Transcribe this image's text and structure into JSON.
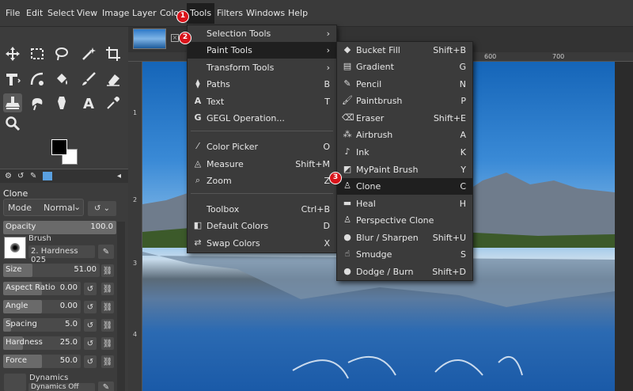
{
  "menubar": [
    "File",
    "Edit",
    "Select",
    "View",
    "Image",
    "Layer",
    "Colors",
    "Tools",
    "Filters",
    "Windows",
    "Help"
  ],
  "tool_options": {
    "title": "Clone",
    "mode_label": "Mode",
    "mode_value": "Normal",
    "opacity": {
      "label": "Opacity",
      "value": "100.0"
    },
    "brush_label": "Brush",
    "brush_value": "2. Hardness 025",
    "size": {
      "label": "Size",
      "value": "51.00"
    },
    "aspect_ratio": {
      "label": "Aspect Ratio",
      "value": "0.00"
    },
    "angle": {
      "label": "Angle",
      "value": "0.00"
    },
    "spacing": {
      "label": "Spacing",
      "value": "5.0"
    },
    "hardness": {
      "label": "Hardness",
      "value": "25.0"
    },
    "force": {
      "label": "Force",
      "value": "50.0"
    },
    "dynamics_label": "Dynamics",
    "dynamics_value": "Dynamics Off"
  },
  "ruler": {
    "top": [
      "600",
      "700"
    ],
    "left": [
      "1",
      "2",
      "3",
      "4"
    ]
  },
  "tools_menu": [
    {
      "label": "Selection Tools",
      "shortcut": "",
      "submenu": true
    },
    {
      "label": "Paint Tools",
      "shortcut": "",
      "submenu": true
    },
    {
      "label": "Transform Tools",
      "shortcut": "",
      "submenu": true
    },
    {
      "label": "Paths",
      "shortcut": "B"
    },
    {
      "label": "Text",
      "shortcut": "T"
    },
    {
      "label": "GEGL Operation...",
      "shortcut": ""
    },
    {
      "label": "Color Picker",
      "shortcut": "O"
    },
    {
      "label": "Measure",
      "shortcut": "Shift+M"
    },
    {
      "label": "Zoom",
      "shortcut": "Z"
    },
    {
      "label": "Toolbox",
      "shortcut": "Ctrl+B"
    },
    {
      "label": "Default Colors",
      "shortcut": "D"
    },
    {
      "label": "Swap Colors",
      "shortcut": "X"
    }
  ],
  "paint_menu": [
    {
      "label": "Bucket Fill",
      "shortcut": "Shift+B"
    },
    {
      "label": "Gradient",
      "shortcut": "G"
    },
    {
      "label": "Pencil",
      "shortcut": "N"
    },
    {
      "label": "Paintbrush",
      "shortcut": "P"
    },
    {
      "label": "Eraser",
      "shortcut": "Shift+E"
    },
    {
      "label": "Airbrush",
      "shortcut": "A"
    },
    {
      "label": "Ink",
      "shortcut": "K"
    },
    {
      "label": "MyPaint Brush",
      "shortcut": "Y"
    },
    {
      "label": "Clone",
      "shortcut": "C"
    },
    {
      "label": "Heal",
      "shortcut": "H"
    },
    {
      "label": "Perspective Clone",
      "shortcut": ""
    },
    {
      "label": "Blur / Sharpen",
      "shortcut": "Shift+U"
    },
    {
      "label": "Smudge",
      "shortcut": "S"
    },
    {
      "label": "Dodge / Burn",
      "shortcut": "Shift+D"
    }
  ],
  "badges": [
    "1",
    "2",
    "3"
  ],
  "colors": {
    "accent": "#d9141b",
    "menu_bg": "#3b3b3b",
    "highlight": "#1f1f1f"
  }
}
